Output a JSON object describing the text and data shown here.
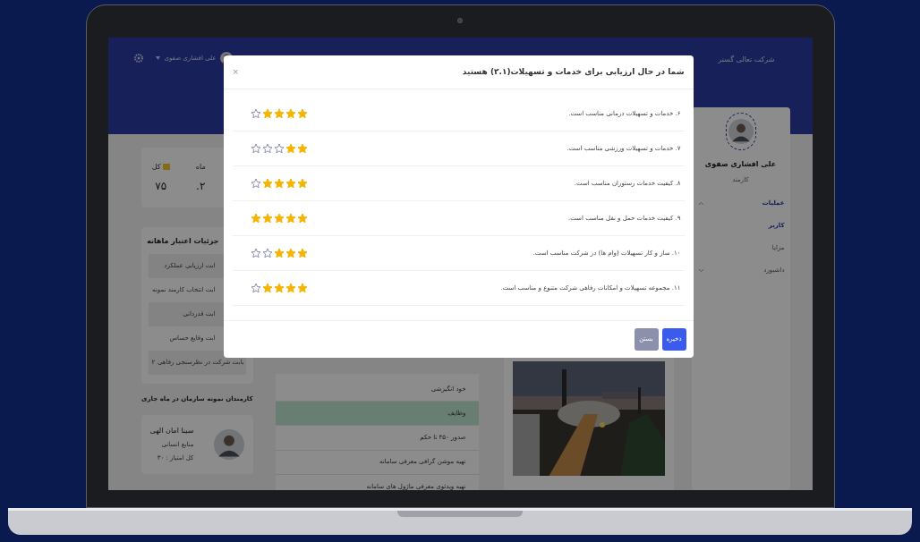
{
  "header": {
    "company": "شرکت تعالی گستر",
    "user_name": "علی افشاری صفوی"
  },
  "profile": {
    "name": "علی افشاری صفوی",
    "role": "کارمند"
  },
  "nav": [
    {
      "label": "عملیات",
      "active": true,
      "kind": "group",
      "expanded": true
    },
    {
      "label": "کاربر",
      "active": true,
      "kind": "link"
    },
    {
      "label": "مزایا",
      "active": false,
      "kind": "link"
    },
    {
      "label": "داشبورد",
      "active": false,
      "kind": "group",
      "expanded": false
    }
  ],
  "stats": [
    {
      "label": "ماه",
      "value": "۲."
    },
    {
      "label": "کل",
      "value": "۷۵"
    }
  ],
  "credit_details": {
    "title": "جزئیات اعتبار ماهانه",
    "rows": [
      {
        "label": "ابت ارزیابی عملکرد",
        "cut": true
      },
      {
        "label": "ابت انتخاب کارمند نمونه",
        "cut": true
      },
      {
        "label": "ابت قدردانی",
        "cut": true
      },
      {
        "label": "ابت وقایع حساس",
        "cut": true
      },
      {
        "label": "بابت شرکت در نظرسنجی رفاهی",
        "value": "۲",
        "cut": false
      }
    ]
  },
  "employees": {
    "title": "کارمندان نمونه سازمان در ماه جاری",
    "items": [
      {
        "name": "سینا امان الهی",
        "department": "منابع انسانی",
        "score": "کل امتیاز : ۳۰"
      }
    ]
  },
  "tasks": [
    {
      "label": "خود انگیزشی",
      "selected": false
    },
    {
      "label": "وظایف",
      "selected": true
    },
    {
      "label": "صدور ۴۵۰ تا حکم",
      "selected": false
    },
    {
      "label": "تهیه موشن گرافی معرفی سامانه",
      "selected": false
    },
    {
      "label": "تهیه ویدئوی معرفی ماژول های سامانه",
      "selected": false
    }
  ],
  "modal": {
    "title": "شما در حال ارزیابی برای خدمات و تسهیلات(۲.۱) هستید",
    "close": "×",
    "items": [
      {
        "text": "۶. خدمات و تسهیلات درمانی مناسب است.",
        "stars": 4
      },
      {
        "text": "۷. خدمات و تسهیلات ورزشی مناسب است.",
        "stars": 2
      },
      {
        "text": "۸. کیفیت خدمات رستوران مناسب است.",
        "stars": 4
      },
      {
        "text": "۹. کیفیت خدمات حمل و نقل مناسب است.",
        "stars": 5
      },
      {
        "text": "۱۰. ساز و کار تسهیلات (وام ها) در شرکت مناسب است.",
        "stars": 3
      },
      {
        "text": "۱۱. مجموعه تسهیلات و امکانات رفاهی شرکت متنوع و مناسب است.",
        "stars": 4
      }
    ],
    "buttons": [
      {
        "label": "ذخیره",
        "kind": "primary"
      },
      {
        "label": "بستن",
        "kind": "secondary"
      }
    ]
  }
}
